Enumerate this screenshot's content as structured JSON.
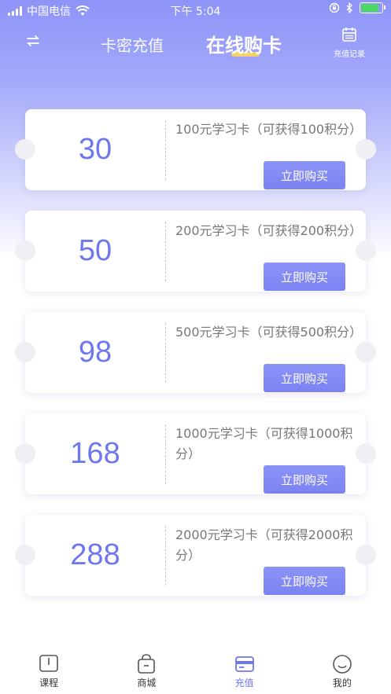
{
  "status_bar": {
    "carrier": "中国电信",
    "time": "下午 5:04"
  },
  "nav": {
    "tab_card_password": "卡密充值",
    "tab_online_buy": "在线购卡",
    "records_label": "充值记录"
  },
  "cards": [
    {
      "price": "30",
      "description": "100元学习卡（可获得100积分）",
      "button": "立即购买"
    },
    {
      "price": "50",
      "description": "200元学习卡（可获得200积分）",
      "button": "立即购买"
    },
    {
      "price": "98",
      "description": "500元学习卡（可获得500积分）",
      "button": "立即购买"
    },
    {
      "price": "168",
      "description": "1000元学习卡（可获得1000积分）",
      "button": "立即购买"
    },
    {
      "price": "288",
      "description": "2000元学习卡（可获得2000积分）",
      "button": "立即购买"
    }
  ],
  "tabbar": {
    "items": [
      {
        "label": "课程",
        "icon": "book-icon",
        "active": false
      },
      {
        "label": "商城",
        "icon": "shopping-bag-icon",
        "active": false
      },
      {
        "label": "充值",
        "icon": "card-icon",
        "active": true
      },
      {
        "label": "我的",
        "icon": "smile-face-icon",
        "active": false
      }
    ]
  },
  "colors": {
    "accent": "#6e77ee",
    "header_gradient_top": "#8d94f7",
    "underline": "#f3d16b",
    "battery": "#4cd964"
  }
}
